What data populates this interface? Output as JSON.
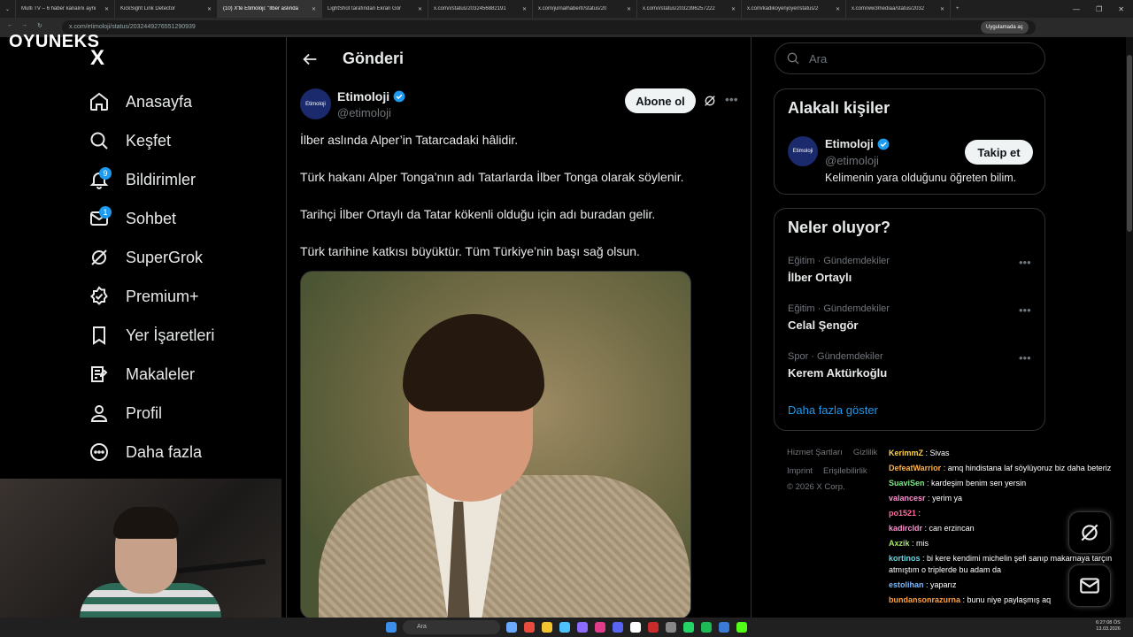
{
  "browser": {
    "tabs": [
      {
        "label": "Multi TV – 6 haber kanalını aynı"
      },
      {
        "label": "KickSight Link Detector"
      },
      {
        "label": "(10) X'te Etimoloji: \"İlber aslında"
      },
      {
        "label": "LightShot tarafından Ekran Gör"
      },
      {
        "label": "x.com/i/status/2032456882191"
      },
      {
        "label": "x.com/jurnalhabertr/status/20"
      },
      {
        "label": "x.com/i/status/2032396257222"
      },
      {
        "label": "x.com/kadikoyenjoyer/status/2"
      },
      {
        "label": "x.com/ww3mediaa/status/2032"
      }
    ],
    "url": "x.com/etimoloji/status/2032449276551290939",
    "extension_label": "Uygulamada aç"
  },
  "overlay": {
    "brand": "OYUNEKS"
  },
  "nav": {
    "logo": "X",
    "items": [
      {
        "label": "Anasayfa",
        "icon": "home-icon"
      },
      {
        "label": "Keşfet",
        "icon": "search-icon"
      },
      {
        "label": "Bildirimler",
        "icon": "bell-icon",
        "badge": "9"
      },
      {
        "label": "Sohbet",
        "icon": "mail-icon",
        "badge": "1"
      },
      {
        "label": "SuperGrok",
        "icon": "grok-icon"
      },
      {
        "label": "Premium+",
        "icon": "premium-icon"
      },
      {
        "label": "Yer İşaretleri",
        "icon": "bookmark-icon"
      },
      {
        "label": "Makaleler",
        "icon": "articles-icon"
      },
      {
        "label": "Profil",
        "icon": "profile-icon"
      },
      {
        "label": "Daha fazla",
        "icon": "more-icon"
      }
    ]
  },
  "post": {
    "header_title": "Gönderi",
    "author_name": "Etimoloji",
    "author_handle": "@etimoloji",
    "avatar_text": "Etimoloji",
    "follow_label": "Abone ol",
    "paragraphs": [
      "İlber aslında Alper’in Tatarcadaki hâlidir.",
      "Türk hakanı Alper Tonga’nın adı Tatarlarda İlber Tonga olarak söylenir.",
      "Tarihçi İlber Ortaylı da Tatar kökenli olduğu için adı buradan gelir.",
      "Türk tarihine katkısı büyüktür. Tüm Türkiye’nin başı sağ olsun."
    ]
  },
  "sidebar": {
    "search_placeholder": "Ara",
    "related_title": "Alakalı kişiler",
    "related": {
      "name": "Etimoloji",
      "handle": "@etimoloji",
      "bio": "Kelimenin yara olduğunu öğreten bilim.",
      "follow_label": "Takip et",
      "avatar_text": "Etimoloji"
    },
    "trends_title": "Neler oluyor?",
    "trends": [
      {
        "meta": "Eğitim · Gündemdekiler",
        "name": "İlber Ortaylı"
      },
      {
        "meta": "Eğitim · Gündemdekiler",
        "name": "Celal Şengör"
      },
      {
        "meta": "Spor · Gündemdekiler",
        "name": "Kerem Aktürkoğlu"
      }
    ],
    "show_more": "Daha fazla göster",
    "footer_row1": [
      "Hizmet Şartları",
      "Gizlilik"
    ],
    "footer_row2": [
      "Imprint",
      "Erişilebilirlik"
    ],
    "copyright": "© 2026 X Corp."
  },
  "chat": [
    {
      "user": "KerimmZ",
      "msg": "Sivas",
      "color": "#ffd24d"
    },
    {
      "user": "DefeatWarrior",
      "msg": "amq hindistana laf söylüyoruz biz daha beteriz",
      "color": "#ffb347"
    },
    {
      "user": "SuaviSen",
      "msg": "kardeşim benim sen yersin",
      "color": "#7ee787"
    },
    {
      "user": "valancesr",
      "msg": "yerim ya",
      "color": "#ff8fd0"
    },
    {
      "user": "po1521",
      "msg": "",
      "color": "#ff6b9a"
    },
    {
      "user": "kadircldr",
      "msg": "can erzincan",
      "color": "#ff8fd0"
    },
    {
      "user": "Axzik",
      "msg": "mis",
      "color": "#a6e36b"
    },
    {
      "user": "kortinos",
      "msg": "bi kere kendimi michelin şefi sanıp makarnaya tarçın atmıştım o triplerde bu adam da",
      "color": "#66d9e8"
    },
    {
      "user": "estolihan",
      "msg": "yaparız",
      "color": "#7ab8ff"
    },
    {
      "user": "bundansonrazurna",
      "msg": "bunu niye paylaşmış aq",
      "color": "#ff9f43"
    }
  ],
  "taskbar": {
    "search": "Ara",
    "time": "6:27:08 ÖS",
    "date": "13.03.2026"
  }
}
